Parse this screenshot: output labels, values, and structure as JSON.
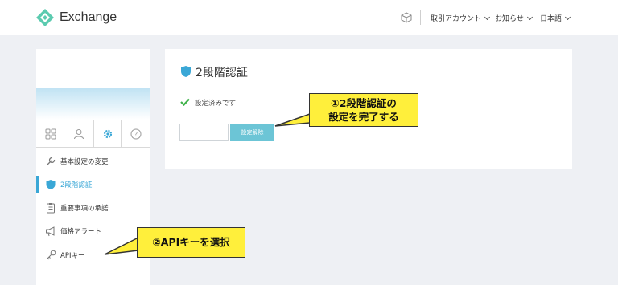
{
  "header": {
    "brand": "Exchange",
    "menu": [
      {
        "label": "取引アカウント"
      },
      {
        "label": "お知らせ"
      },
      {
        "label": "日本語"
      }
    ]
  },
  "sidebar": {
    "items": [
      {
        "label": "基本設定の変更",
        "icon": "wrench-icon"
      },
      {
        "label": "2段階認証",
        "icon": "shield-icon",
        "active": true
      },
      {
        "label": "重要事項の承諾",
        "icon": "clipboard-icon"
      },
      {
        "label": "価格アラート",
        "icon": "megaphone-icon"
      },
      {
        "label": "APIキー",
        "icon": "key-icon"
      }
    ],
    "tabs": [
      "grid-icon",
      "user-icon",
      "gear-icon",
      "help-icon"
    ]
  },
  "panel": {
    "title": "2段階認証",
    "status": "設定済みです",
    "button_label": "設定解除",
    "input_value": ""
  },
  "callouts": {
    "one_line1": "①2段階認証の",
    "one_line2": "設定を完了する",
    "two": "②APIキーを選択"
  },
  "colors": {
    "accent": "#3aa7d6",
    "button": "#6cc5d6",
    "callout": "#ffef3b",
    "check": "#3fb24a"
  }
}
